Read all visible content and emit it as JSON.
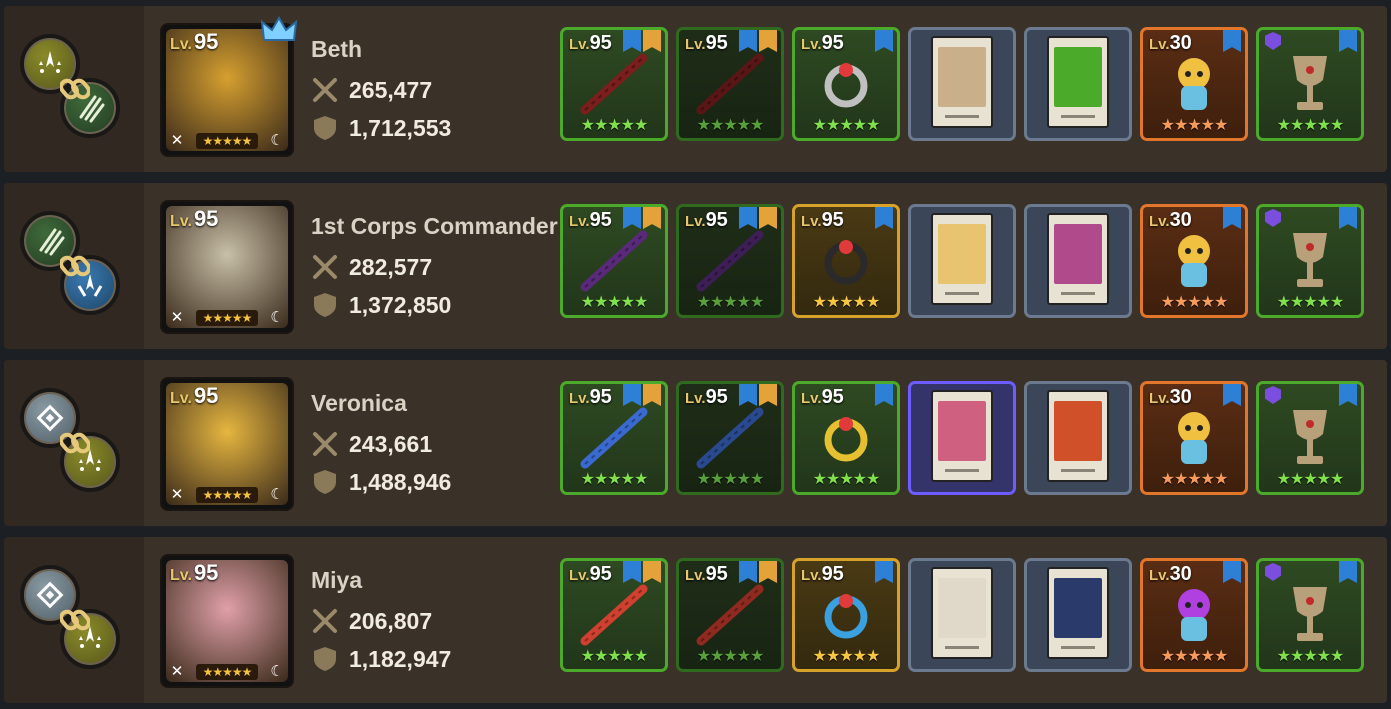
{
  "heroes": [
    {
      "name": "Beth",
      "level": "95",
      "attack": "265,477",
      "defense": "1,712,553",
      "portrait_color": "#d6a030",
      "chain": [
        "olive",
        "green"
      ],
      "crown": true,
      "slots": [
        {
          "type": "weapon",
          "level": "95",
          "variant": "green",
          "color": "#7a1e1e",
          "stars": "★★★★★"
        },
        {
          "type": "weapon",
          "level": "95",
          "variant": "dim",
          "color": "#5a1616",
          "stars": "★★★★★"
        },
        {
          "type": "accessory",
          "level": "95",
          "variant": "green",
          "color": "#c0c0c0",
          "stars": "★★★★★"
        },
        {
          "type": "card",
          "variant": "card",
          "color": "#c9b08a"
        },
        {
          "type": "card",
          "variant": "card",
          "color": "#4caa2a"
        },
        {
          "type": "costume",
          "level": "30",
          "variant": "orange",
          "color": "#f0c040",
          "stars": "★★★★★"
        },
        {
          "type": "relic",
          "variant": "green",
          "color": "#b8a07a",
          "stars": "★★★★★"
        }
      ]
    },
    {
      "name": "1st Corps Commander",
      "level": "95",
      "attack": "282,577",
      "defense": "1,372,850",
      "portrait_color": "#c8c0a8",
      "chain": [
        "green",
        "blue"
      ],
      "crown": false,
      "slots": [
        {
          "type": "weapon",
          "level": "95",
          "variant": "green",
          "color": "#5a2a7a",
          "stars": "★★★★★"
        },
        {
          "type": "weapon",
          "level": "95",
          "variant": "dim",
          "color": "#3e1e56",
          "stars": "★★★★★"
        },
        {
          "type": "accessory",
          "level": "95",
          "variant": "gold",
          "color": "#2a2a2a",
          "stars": "★★★★★"
        },
        {
          "type": "card",
          "variant": "card",
          "color": "#e8c470"
        },
        {
          "type": "card",
          "variant": "card",
          "color": "#b04a8a"
        },
        {
          "type": "costume",
          "level": "30",
          "variant": "orange",
          "color": "#f0c040",
          "stars": "★★★★★"
        },
        {
          "type": "relic",
          "variant": "green",
          "color": "#b8a07a",
          "stars": "★★★★★"
        }
      ]
    },
    {
      "name": "Veronica",
      "level": "95",
      "attack": "243,661",
      "defense": "1,488,946",
      "portrait_color": "#e6b640",
      "chain": [
        "gray",
        "olive"
      ],
      "crown": false,
      "slots": [
        {
          "type": "weapon",
          "level": "95",
          "variant": "green",
          "color": "#3a6ad0",
          "stars": "★★★★★"
        },
        {
          "type": "weapon",
          "level": "95",
          "variant": "dim",
          "color": "#2a4a90",
          "stars": "★★★★★"
        },
        {
          "type": "accessory",
          "level": "95",
          "variant": "green",
          "color": "#e6c030",
          "stars": "★★★★★"
        },
        {
          "type": "card",
          "variant": "purple",
          "color": "#d06080"
        },
        {
          "type": "card",
          "variant": "card",
          "color": "#d0502a"
        },
        {
          "type": "costume",
          "level": "30",
          "variant": "orange",
          "color": "#f0c040",
          "stars": "★★★★★"
        },
        {
          "type": "relic",
          "variant": "green",
          "color": "#b8a07a",
          "stars": "★★★★★"
        }
      ]
    },
    {
      "name": "Miya",
      "level": "95",
      "attack": "206,807",
      "defense": "1,182,947",
      "portrait_color": "#e0a0a8",
      "chain": [
        "gray",
        "olive"
      ],
      "crown": false,
      "slots": [
        {
          "type": "weapon",
          "level": "95",
          "variant": "green",
          "color": "#d04030",
          "stars": "★★★★★"
        },
        {
          "type": "weapon",
          "level": "95",
          "variant": "dim",
          "color": "#902a20",
          "stars": "★★★★★"
        },
        {
          "type": "accessory",
          "level": "95",
          "variant": "gold",
          "color": "#3aa0e0",
          "stars": "★★★★★"
        },
        {
          "type": "card",
          "variant": "card",
          "color": "#e0d8c8"
        },
        {
          "type": "card",
          "variant": "card",
          "color": "#2a3a6a"
        },
        {
          "type": "costume",
          "level": "30",
          "variant": "orange",
          "color": "#b040e0",
          "stars": "★★★★★"
        },
        {
          "type": "relic",
          "variant": "green",
          "color": "#b8a07a",
          "stars": "★★★★★"
        }
      ]
    }
  ],
  "level_prefix": "Lv."
}
